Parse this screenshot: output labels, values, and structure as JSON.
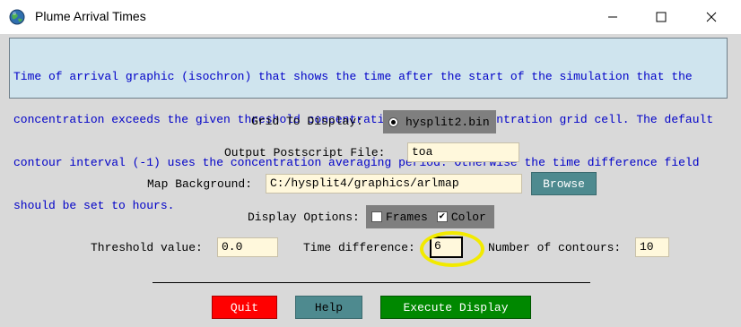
{
  "window": {
    "title": "Plume Arrival Times",
    "controls": [
      "minimize-icon",
      "maximize-icon",
      "close-icon"
    ],
    "app_icon": "globe-icon"
  },
  "description": {
    "lines": [
      "Time of arrival graphic (isochron) that shows the time after the start of the simulation that the",
      "concentration exceeds the given threshold concentration at each concentration grid cell. The default",
      "contour interval (-1) uses the concentration averaging period. Otherwise the time difference field",
      "should be set to hours."
    ]
  },
  "grid": {
    "label": "Grid To Display:",
    "option": "hysplit2.bin",
    "selected": true
  },
  "output": {
    "label": "Output Postscript File:",
    "value": "toa"
  },
  "map": {
    "label": "Map Background:",
    "value": "C:/hysplit4/graphics/arlmap",
    "browse_label": "Browse"
  },
  "display": {
    "label": "Display Options:",
    "frames_label": "Frames",
    "frames_checked": false,
    "color_label": "Color",
    "color_checked": true,
    "check_mark": "✔"
  },
  "threshold": {
    "label": "Threshold value:",
    "value": "0.0"
  },
  "time_diff": {
    "label": "Time difference:",
    "value": "6"
  },
  "contours": {
    "label": "Number of contours:",
    "value": "10"
  },
  "buttons": {
    "quit": "Quit",
    "help": "Help",
    "execute": "Execute Display"
  },
  "colors": {
    "description_text": "#0000c8",
    "description_bg": "#cfe4ee",
    "field_bg": "#fff8dc",
    "quit_bg": "#ff0000",
    "help_bg": "#4e8a8f",
    "execute_bg": "#008800",
    "highlight": "#f2ea00"
  }
}
